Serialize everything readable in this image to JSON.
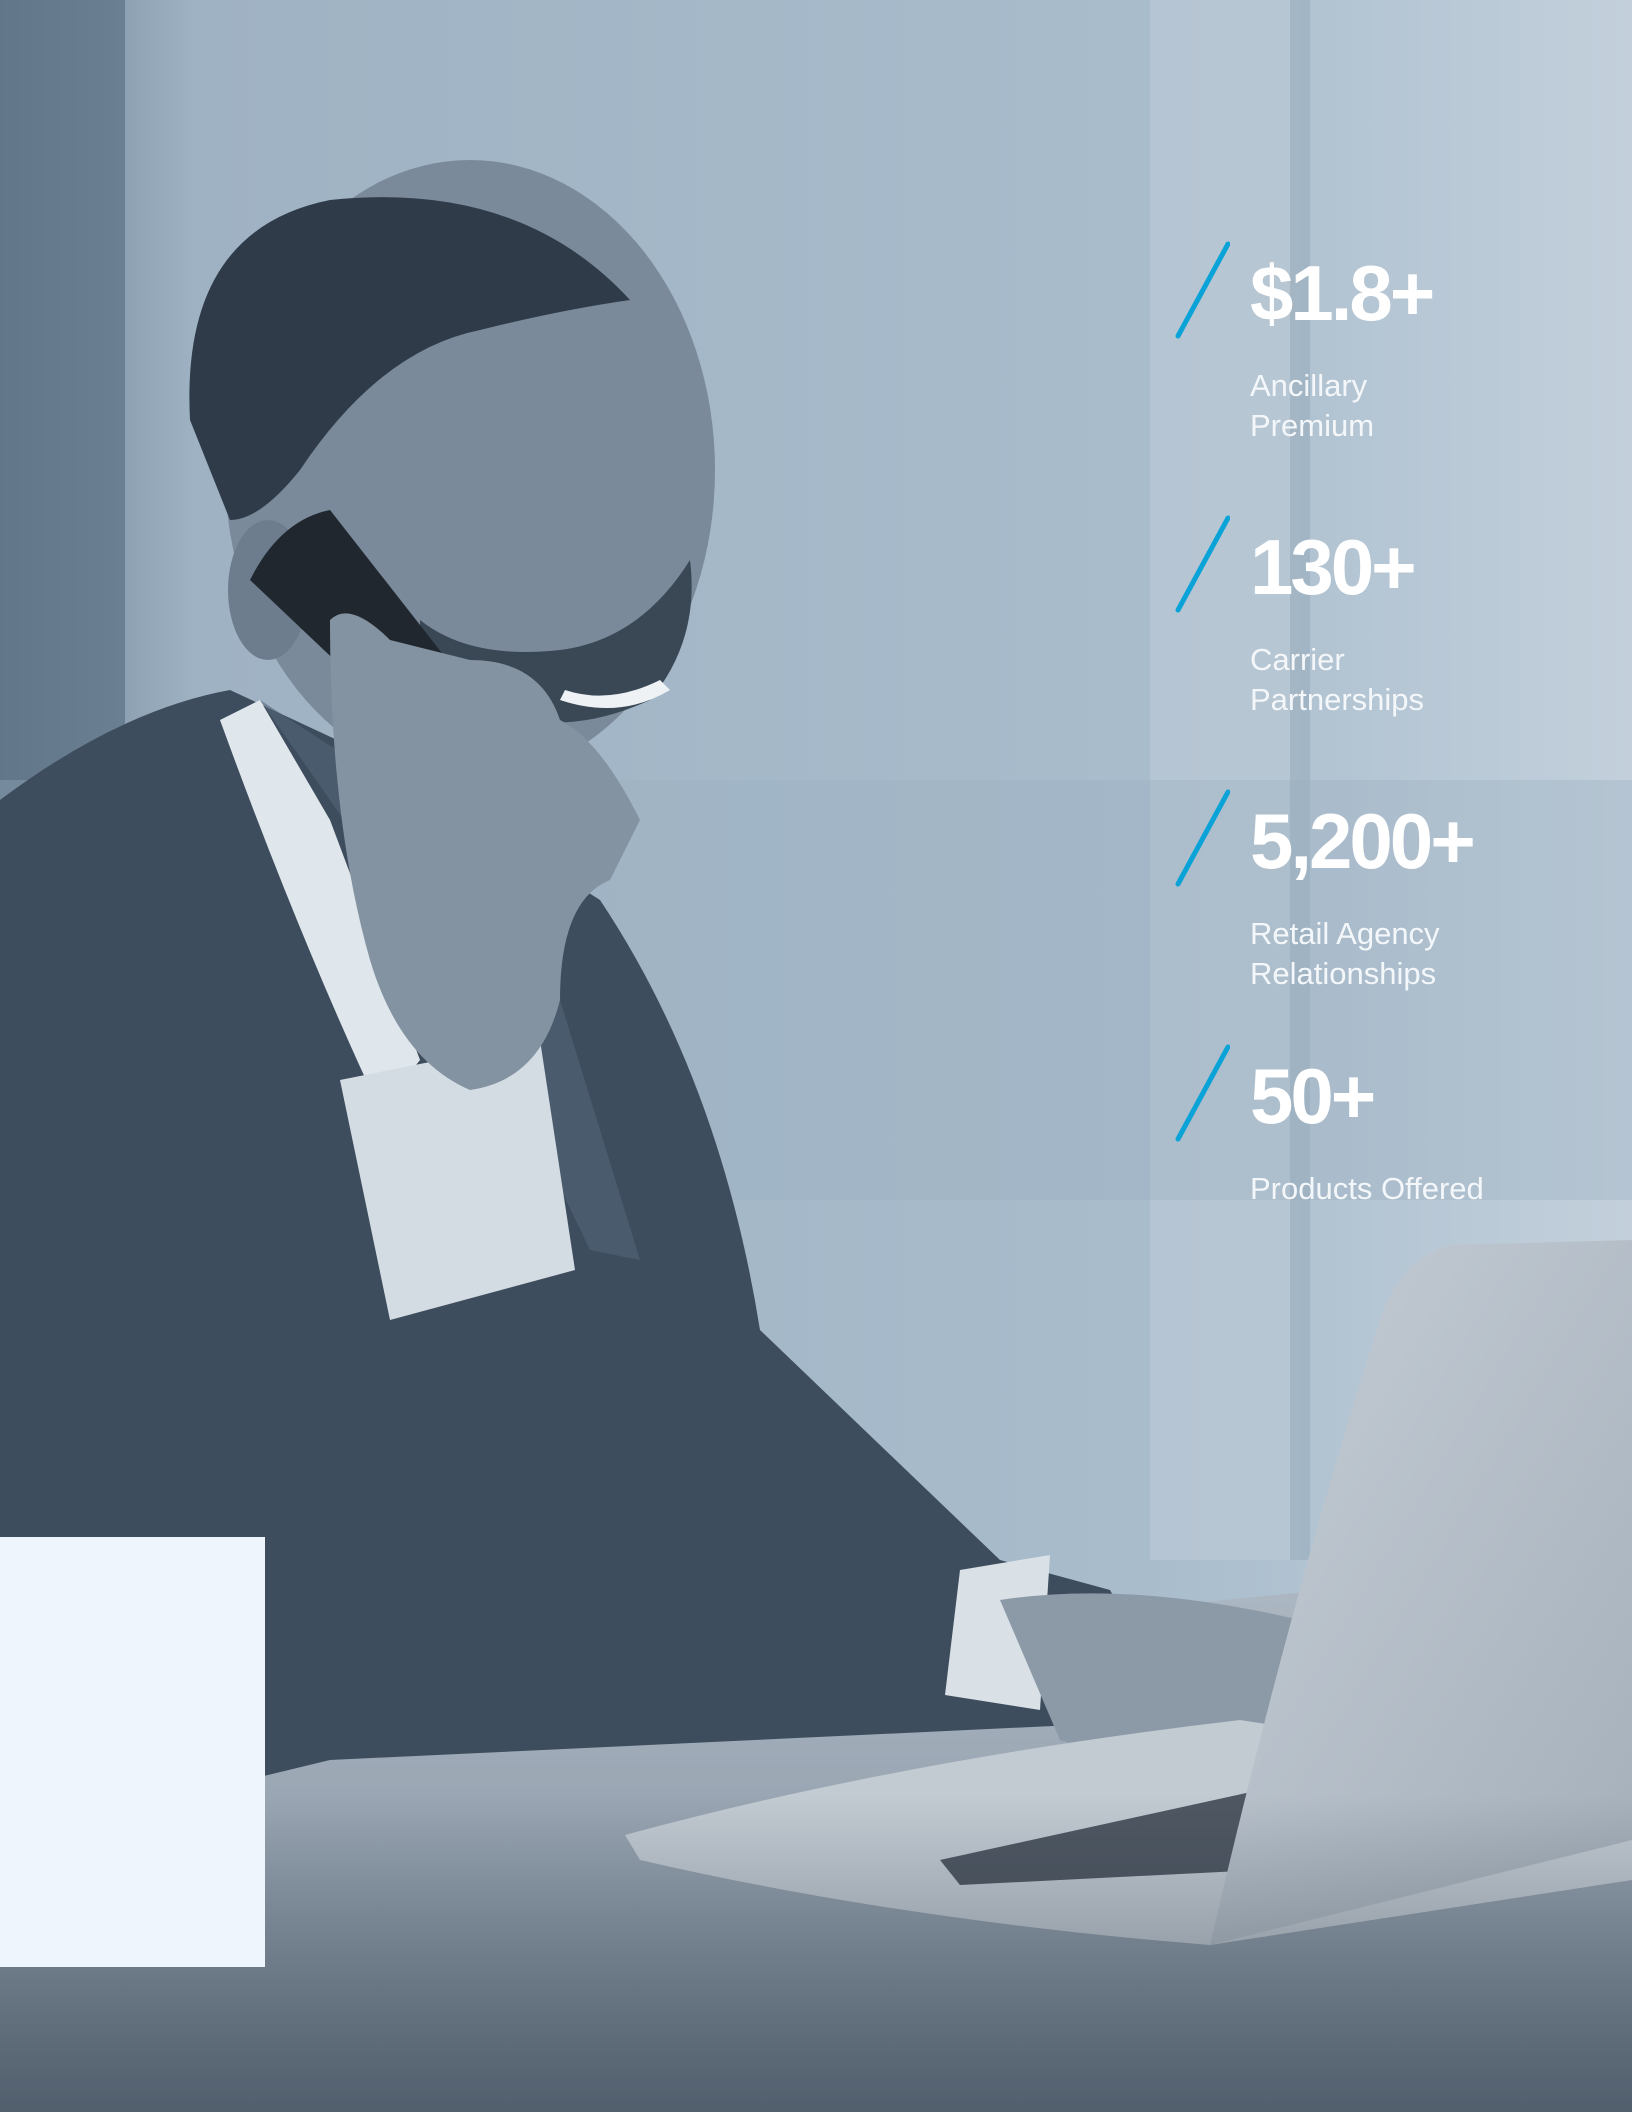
{
  "colors": {
    "accent": "#0aa3d8",
    "overlay_top": "#a7bac9",
    "overlay_dark": "#3b4a5a",
    "stat_text": "#ffffff",
    "panel": "#eef5fd"
  },
  "stats": [
    {
      "value": "$1.8+",
      "label_line1": "Ancillary",
      "label_line2": "Premium"
    },
    {
      "value": "130+",
      "label_line1": "Carrier",
      "label_line2": "Partnerships"
    },
    {
      "value": "5,200+",
      "label_line1": "Retail Agency",
      "label_line2": "Relationships"
    },
    {
      "value": "50+",
      "label_line1": "Products Offered",
      "label_line2": ""
    }
  ]
}
